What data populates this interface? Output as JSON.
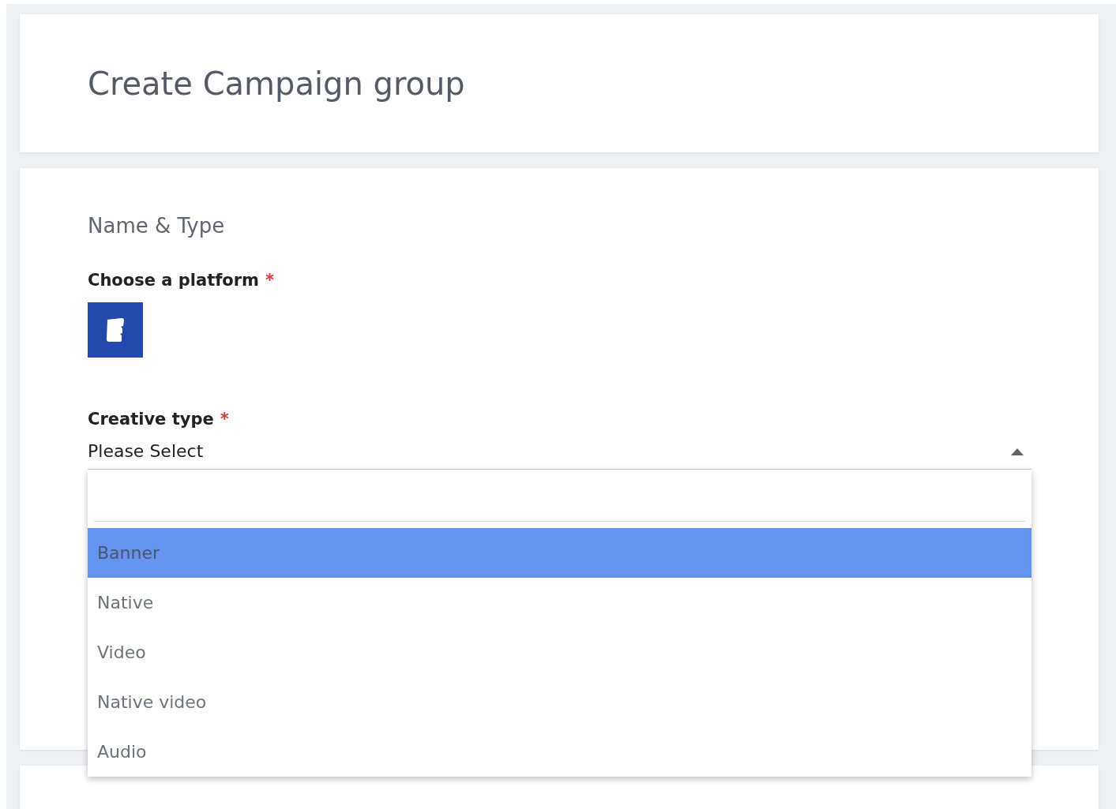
{
  "header": {
    "title": "Create Campaign group"
  },
  "section": {
    "title": "Name & Type",
    "platform": {
      "label": "Choose a platform",
      "required_mark": "*"
    },
    "creative_type": {
      "label": "Creative type",
      "required_mark": "*",
      "value": "Please Select",
      "expanded": true,
      "options": [
        {
          "label": "Banner",
          "selected": true
        },
        {
          "label": "Native",
          "selected": false
        },
        {
          "label": "Video",
          "selected": false
        },
        {
          "label": "Native video",
          "selected": false
        },
        {
          "label": "Audio",
          "selected": false
        }
      ]
    }
  }
}
